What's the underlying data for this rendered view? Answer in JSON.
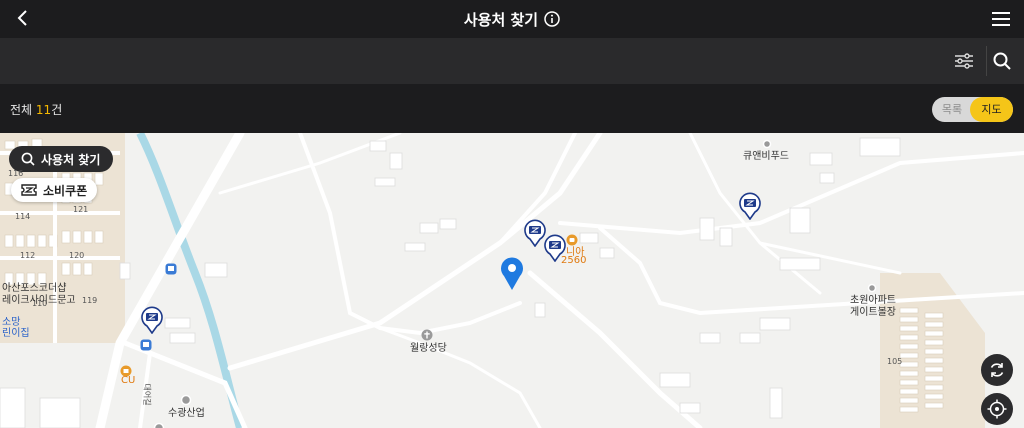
{
  "header": {
    "title": "사용처 찾기"
  },
  "results": {
    "prefix": "전체 ",
    "count": "11",
    "suffix": "건"
  },
  "view_toggle": {
    "list_label": "목록",
    "map_label": "지도",
    "active": "지도"
  },
  "map": {
    "search_here_label": "사용처 찾기",
    "coupon_label": "소비쿠폰",
    "places": {
      "q_and_b": "큐앤비푸드",
      "chowon": "초원아파트",
      "chowon_gate": "게이트볼장",
      "wollang": "월랑성당",
      "sugwang": "수광산업",
      "cu": "CU",
      "store_partial": "니아",
      "store_partial_num": "2560",
      "asan_line1": "아산포스코더샵",
      "asan_line2": "레이크사이드문고",
      "somang_line1": "소망",
      "somang_line2": "린이집",
      "road_text": "대어길"
    },
    "block_numbers": [
      "116",
      "114",
      "121",
      "112",
      "120",
      "110",
      "119",
      "105"
    ]
  },
  "colors": {
    "accent": "#f5c518",
    "pin_blue": "#1f7ae0",
    "marker_navy": "#1e3a8a",
    "water": "#a9d8e6",
    "orange": "#e07a10"
  }
}
